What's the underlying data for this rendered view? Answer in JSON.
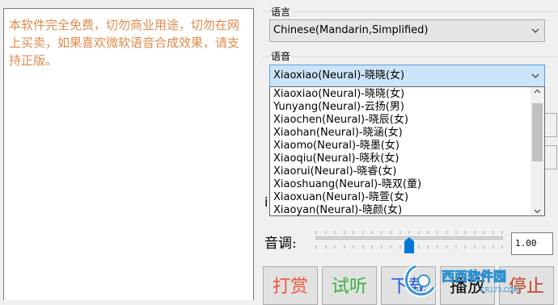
{
  "notice": {
    "text": "本软件完全免费，切勿商业用途，切勿在网上买卖，如果喜欢微软语音合成效果，请支持正版。"
  },
  "language": {
    "label": "语言",
    "selected": "Chinese(Mandarin,Simplified)"
  },
  "voice": {
    "label": "语音",
    "selected": "Xiaoxiao(Neural)-晓晓(女)",
    "options": [
      "Xiaoxiao(Neural)-晓晓(女)",
      "Yunyang(Neural)-云扬(男)",
      "Xiaochen(Neural)-晓辰(女)",
      "Xiaohan(Neural)-晓涵(女)",
      "Xiaomo(Neural)-晓墨(女)",
      "Xiaoqiu(Neural)-晓秋(女)",
      "Xiaorui(Neural)-晓睿(女)",
      "Xiaoshuang(Neural)-晓双(童)",
      "Xiaoxuan(Neural)-晓萱(女)",
      "Xiaoyan(Neural)-晓颜(女)"
    ]
  },
  "partial_label": "i",
  "tone": {
    "label": "音调:",
    "value": "1.00",
    "level": 0.5
  },
  "buttons": [
    {
      "label": "打赏",
      "color": "#f0563a"
    },
    {
      "label": "试听",
      "color": "#3cb043"
    },
    {
      "label": "下载",
      "color": "#1e5bd6"
    },
    {
      "label": "播放",
      "color": "#000000"
    },
    {
      "label": "停止",
      "color": "#c04020"
    }
  ],
  "watermark": {
    "text": "西西软件园",
    "sub": "CR173.COM"
  }
}
